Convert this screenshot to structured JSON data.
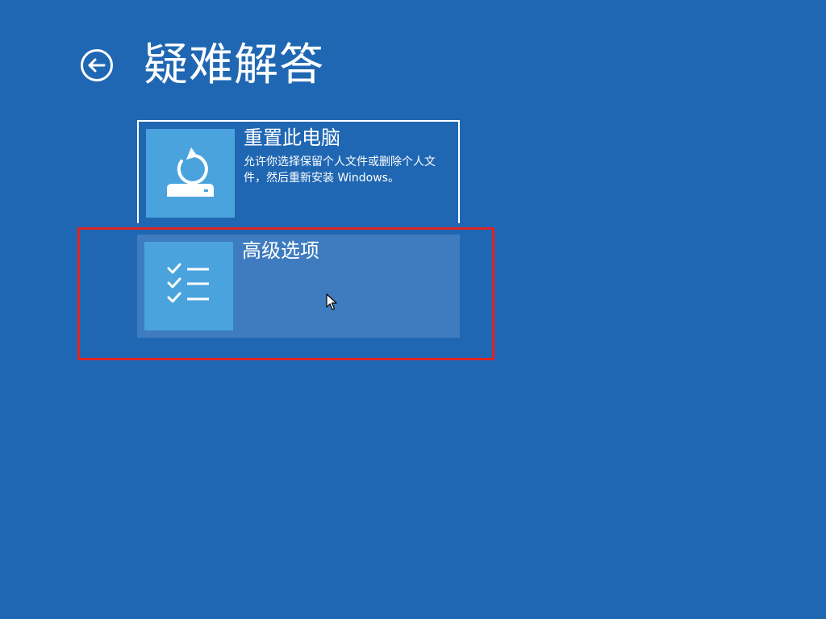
{
  "page": {
    "title": "疑难解答",
    "background_color": "#1f67b3"
  },
  "back_button": {
    "icon": "back-arrow-icon"
  },
  "options": [
    {
      "title": "重置此电脑",
      "description": "允许你选择保留个人文件或删除个人文件，然后重新安装 Windows。",
      "icon": "reset-pc-icon",
      "icon_bg": "#4ba3de"
    },
    {
      "title": "高级选项",
      "description": "",
      "icon": "checklist-icon",
      "icon_bg": "#4ba3de",
      "state": "hover"
    }
  ],
  "annotation": {
    "highlight_color": "#e02424",
    "highlighted_option": "高级选项"
  }
}
